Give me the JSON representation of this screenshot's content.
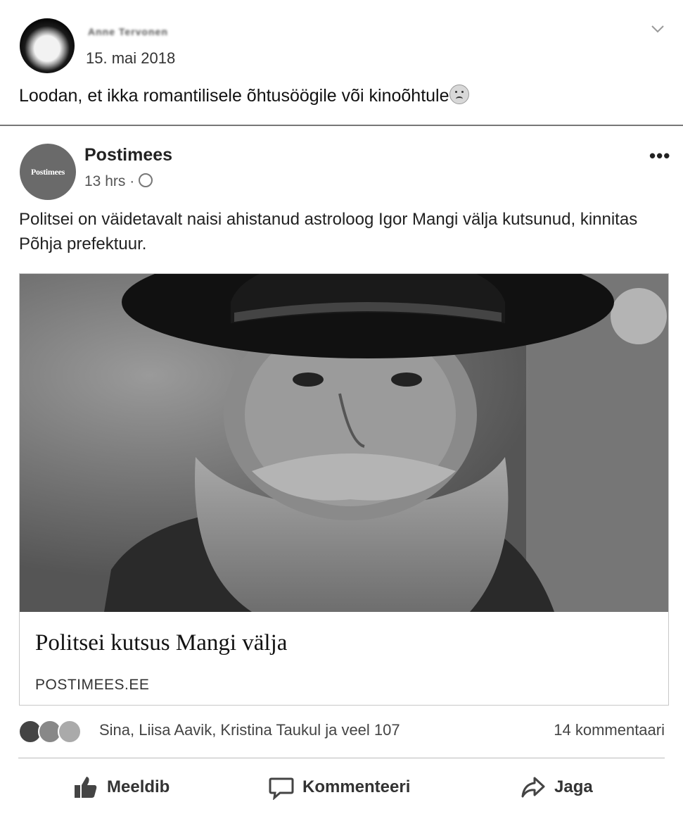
{
  "post": {
    "author": "Anne Tervonen",
    "date": "15. mai 2018",
    "text": "Loodan, et ikka romantilisele õhtusöögile või kinoõhtule"
  },
  "shared_post": {
    "page_name": "Postimees",
    "page_logo_text": "Postimees",
    "time": "13 hrs ·",
    "text": "Politsei on väidetavalt naisi ahistanud astroloog Igor Mangi välja kutsunud, kinnitas Põhja prefektuur.",
    "link": {
      "title": "Politsei kutsus Mangi välja",
      "domain": "POSTIMEES.EE"
    }
  },
  "reactions": {
    "icons": [
      "like-icon",
      "haha-icon",
      "wow-icon"
    ],
    "names": "Sina, Liisa Aavik, Kristina Taukul ja veel 107",
    "comments": "14 kommentaari"
  },
  "actions": {
    "like": "Meeldib",
    "comment": "Kommenteeri",
    "share": "Jaga"
  }
}
